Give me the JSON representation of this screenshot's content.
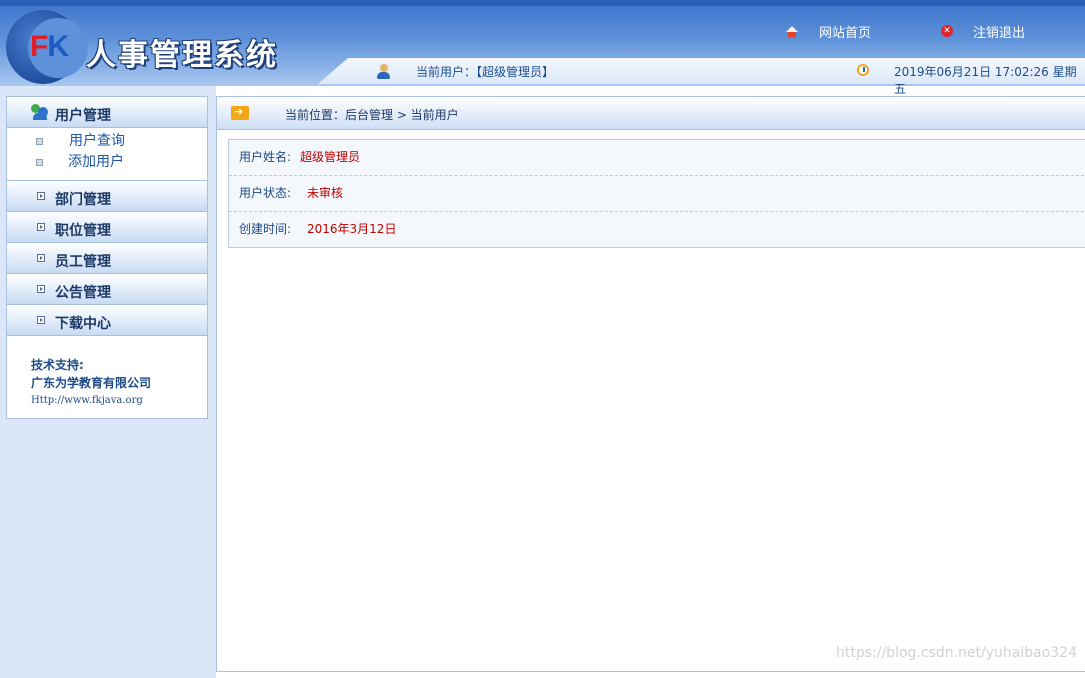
{
  "header": {
    "logo_f": "F",
    "logo_k": "K",
    "title": "人事管理系统",
    "home_link": "网站首页",
    "logout_link": "注销退出",
    "current_user": "当前用户：【超级管理员】",
    "datetime": "2019年06月21日 17:02:26 星期五"
  },
  "sidebar": {
    "menus": [
      {
        "label": "用户管理",
        "items": [
          "用户查询",
          "添加用户"
        ]
      },
      {
        "label": "部门管理"
      },
      {
        "label": "职位管理"
      },
      {
        "label": "员工管理"
      },
      {
        "label": "公告管理"
      },
      {
        "label": "下载中心"
      }
    ],
    "support": {
      "title": "技术支持:",
      "company": "广东为学教育有限公司",
      "url": "Http://www.fkjava.org"
    }
  },
  "main": {
    "breadcrumb": "当前位置：后台管理 > 当前用户",
    "fields": [
      {
        "label": "用户姓名:",
        "value": "超级管理员"
      },
      {
        "label": "用户状态:",
        "value": "未审核"
      },
      {
        "label": "创建时间:",
        "value": "2016年3月12日"
      }
    ]
  },
  "watermark": "https://blog.csdn.net/yuhaibao324",
  "colors": {
    "header_blue": "#3b73c9",
    "accent_red": "#c00000",
    "link_blue": "#1d57a5"
  }
}
